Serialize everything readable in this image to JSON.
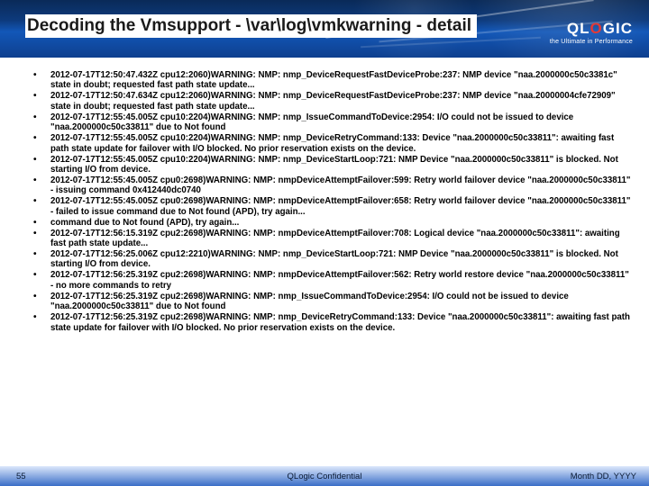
{
  "title": "Decoding the Vmsupport - \\var\\log\\vmkwarning - detail",
  "logo": {
    "brand_pre": "QL",
    "brand_o": "O",
    "brand_post": "GIC",
    "tagline": "the Ultimate in Performance"
  },
  "log_entries": [
    "2012-07-17T12:50:47.432Z cpu12:2060)WARNING: NMP: nmp_DeviceRequestFastDeviceProbe:237: NMP device \"naa.2000000c50c3381c\" state in doubt; requested fast path state update...",
    "2012-07-17T12:50:47.634Z cpu12:2060)WARNING: NMP: nmp_DeviceRequestFastDeviceProbe:237: NMP device \"naa.20000004cfe72909\" state in doubt; requested fast path state update...",
    "2012-07-17T12:55:45.005Z cpu10:2204)WARNING: NMP: nmp_IssueCommandToDevice:2954: I/O could not be issued to device \"naa.2000000c50c33811\" due to Not found",
    "2012-07-17T12:55:45.005Z cpu10:2204)WARNING: NMP: nmp_DeviceRetryCommand:133: Device \"naa.2000000c50c33811\": awaiting fast path state update for failover with I/O blocked. No prior reservation exists on the device.",
    "2012-07-17T12:55:45.005Z cpu10:2204)WARNING: NMP: nmp_DeviceStartLoop:721: NMP Device \"naa.2000000c50c33811\" is blocked. Not starting I/O from device.",
    "2012-07-17T12:55:45.005Z cpu0:2698)WARNING: NMP: nmpDeviceAttemptFailover:599: Retry world failover device \"naa.2000000c50c33811\" - issuing command 0x412440dc0740",
    "2012-07-17T12:55:45.005Z cpu0:2698)WARNING: NMP: nmpDeviceAttemptFailover:658: Retry world failover device \"naa.2000000c50c33811\" - failed to issue command due to Not found (APD), try again...",
    "command due to Not found (APD), try again...",
    "2012-07-17T12:56:15.319Z cpu2:2698)WARNING: NMP: nmpDeviceAttemptFailover:708: Logical device \"naa.2000000c50c33811\": awaiting fast path state update...",
    "2012-07-17T12:56:25.006Z cpu12:2210)WARNING: NMP: nmp_DeviceStartLoop:721: NMP Device \"naa.2000000c50c33811\" is blocked. Not starting I/O from device.",
    "2012-07-17T12:56:25.319Z cpu2:2698)WARNING: NMP: nmpDeviceAttemptFailover:562: Retry world restore device \"naa.2000000c50c33811\" - no more commands to retry",
    "2012-07-17T12:56:25.319Z cpu2:2698)WARNING: NMP: nmp_IssueCommandToDevice:2954: I/O could not be issued to device \"naa.2000000c50c33811\" due to Not found",
    "2012-07-17T12:56:25.319Z cpu2:2698)WARNING: NMP: nmp_DeviceRetryCommand:133: Device \"naa.2000000c50c33811\": awaiting fast path state update for failover with I/O blocked. No prior reservation exists on the device."
  ],
  "footer": {
    "page": "55",
    "confidential": "QLogic Confidential",
    "date": "Month DD, YYYY"
  }
}
